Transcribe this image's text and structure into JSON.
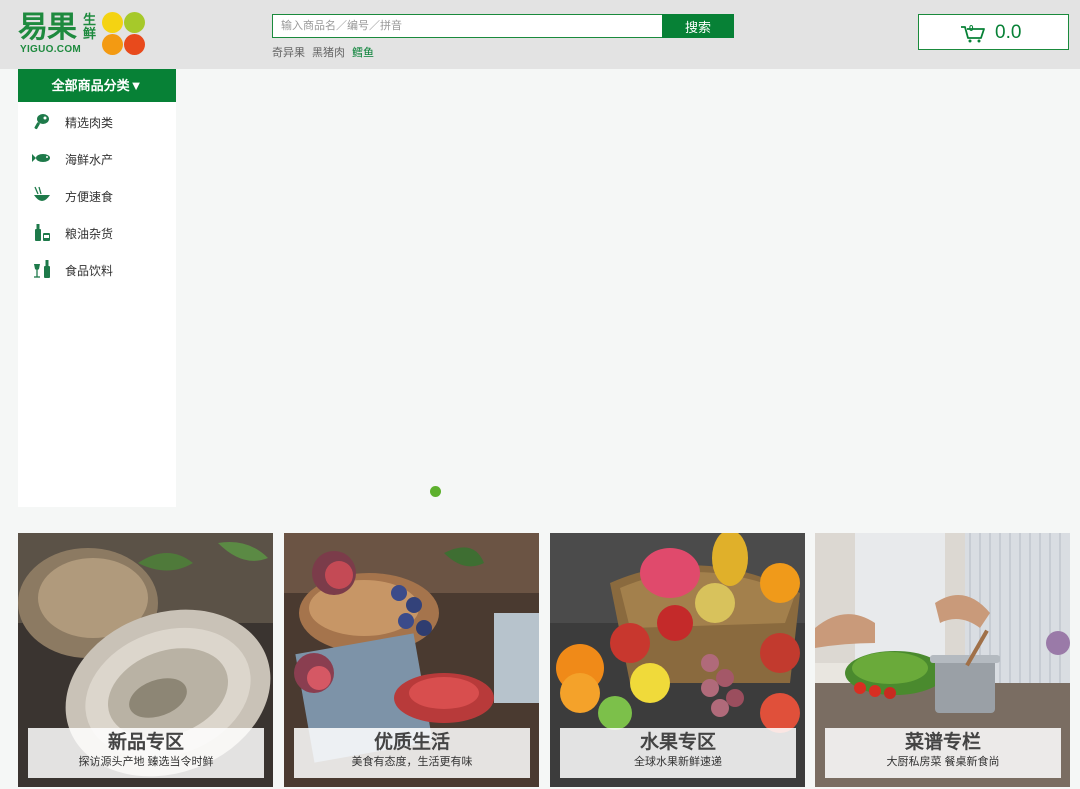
{
  "logo": {
    "main_text": "易果",
    "fresh_text": "生鲜",
    "domain_text": "YIGUO.COM",
    "dot_colors": [
      "#f4d312",
      "#a6c92a",
      "#f39a12",
      "#e84a1c"
    ]
  },
  "search": {
    "placeholder": "输入商品名／编号／拼音",
    "button_label": "搜索",
    "hot_links": [
      {
        "label": "奇异果",
        "active": false
      },
      {
        "label": "黑猪肉",
        "active": false
      },
      {
        "label": "鳕鱼",
        "active": true
      }
    ]
  },
  "cart": {
    "icon": "cart-icon",
    "count": "0",
    "total": "0.0"
  },
  "sidebar": {
    "header_label": "全部商品分类▼",
    "items": [
      {
        "label": "精选肉类",
        "icon": "meat-icon"
      },
      {
        "label": "海鲜水产",
        "icon": "fish-icon"
      },
      {
        "label": "方便速食",
        "icon": "bowl-icon"
      },
      {
        "label": "粮油杂货",
        "icon": "bottles-icon"
      },
      {
        "label": "食品饮料",
        "icon": "wine-icon"
      }
    ]
  },
  "carousel": {
    "active_dot_color": "#5db02d"
  },
  "promos": [
    {
      "title": "新品专区",
      "subtitle": "探访源头产地 臻选当令时鲜",
      "image": "oyster-photo"
    },
    {
      "title": "优质生活",
      "subtitle": "美食有态度，生活更有味",
      "image": "figs-photo"
    },
    {
      "title": "水果专区",
      "subtitle": "全球水果新鲜速递",
      "image": "fruit-basket-photo"
    },
    {
      "title": "菜谱专栏",
      "subtitle": "大厨私房菜 餐桌新食尚",
      "image": "chef-cooking-photo"
    }
  ],
  "colors": {
    "brand_green": "#078136",
    "header_bg": "#e3e3e3",
    "page_bg": "#f5f7f6"
  }
}
